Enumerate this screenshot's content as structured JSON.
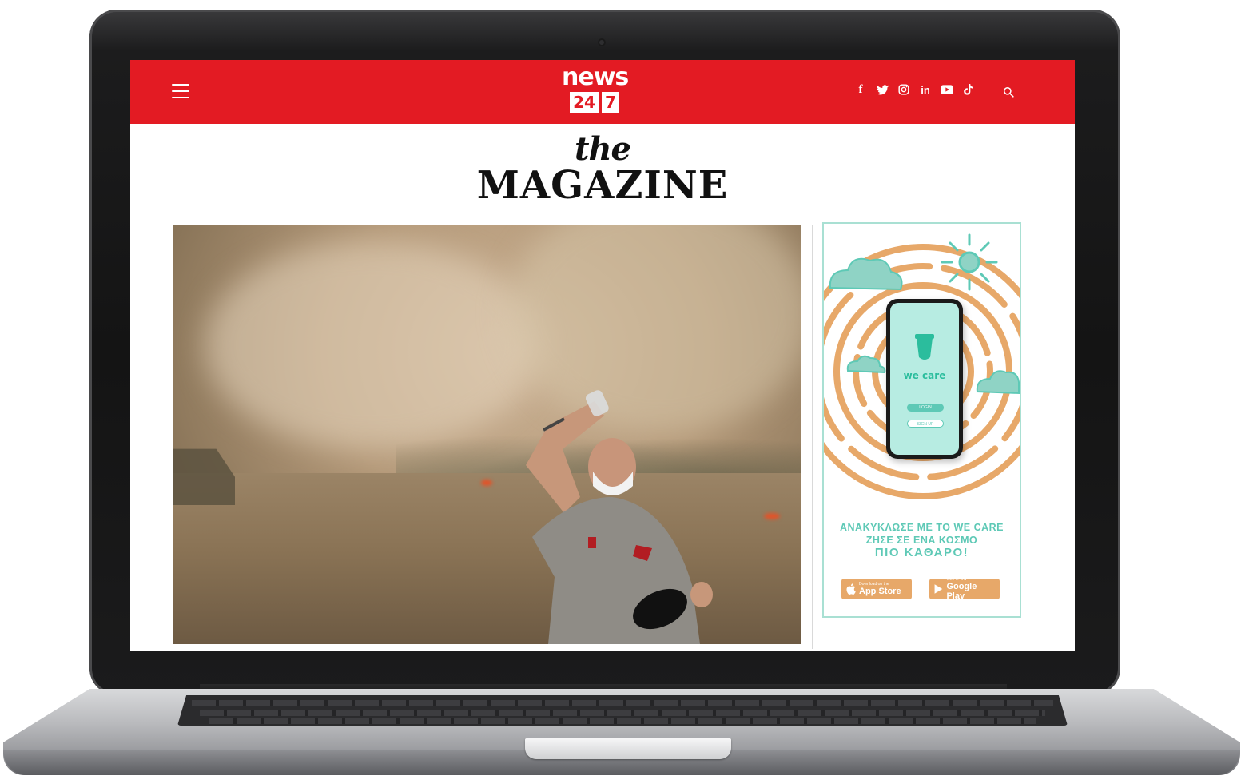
{
  "header": {
    "menu_label": "menu",
    "logo": {
      "word": "news",
      "box1": "24",
      "box2": "7"
    },
    "brand_color": "#e31b23",
    "socials": [
      "facebook-icon",
      "twitter-icon",
      "instagram-icon",
      "linkedin-icon",
      "youtube-icon",
      "tiktok-icon"
    ],
    "social_glyphs": {
      "facebook": "f",
      "linkedin": "in"
    },
    "search_icon": "search-icon"
  },
  "magazine": {
    "the": "the",
    "title": "MAGAZINE"
  },
  "hero": {
    "description_icon": "hero-photo"
  },
  "ad": {
    "phone_brand": "we care",
    "login": "LOGIN",
    "signup": "SIGN UP",
    "line1": "ΑΝΑΚΥΚΛΩΣΕ ΜΕ ΤΟ WE CARE",
    "line2": "ΖΗΣΕ ΣΕ ΕΝΑ ΚΟΣΜΟ",
    "line3": "ΠΙΟ ΚΑΘΑΡΟ!",
    "appstore_small": "Download on the",
    "appstore_name": "App Store",
    "googleplay_small": "GET IT ON",
    "googleplay_name": "Google Play",
    "accent_color": "#5ec9b6",
    "ring_color": "#e7a869"
  }
}
